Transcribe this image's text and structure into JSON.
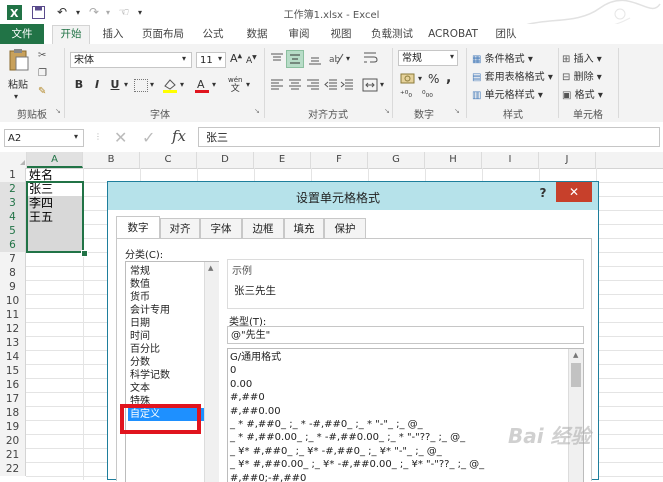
{
  "window": {
    "title": "工作簿1.xlsx - Excel"
  },
  "ribbon_tabs": [
    "文件",
    "开始",
    "插入",
    "页面布局",
    "公式",
    "数据",
    "审阅",
    "视图",
    "负载测试",
    "ACROBAT",
    "团队"
  ],
  "clipboard": {
    "paste_label": "粘贴",
    "group_label": "剪贴板"
  },
  "font": {
    "name": "宋体",
    "size": "11",
    "group_label": "字体",
    "bold": "B",
    "italic": "I",
    "underline": "U",
    "grow": "A",
    "shrink": "A",
    "wen": "wén"
  },
  "alignment": {
    "group_label": "对齐方式"
  },
  "number": {
    "format": "常规",
    "group_label": "数字",
    "percent": "%",
    "comma": ",",
    "inc": "⁺⁰₀",
    "dec": "⁰₀₀"
  },
  "styles": {
    "conditional": "条件格式",
    "table": "套用表格格式",
    "cell": "单元格样式",
    "group_label": "样式"
  },
  "cells": {
    "insert": "插入",
    "delete": "删除",
    "format": "格式",
    "group_label": "单元格"
  },
  "formula_bar": {
    "name_box": "A2",
    "fx": "fx",
    "value": "张三"
  },
  "columns": [
    "A",
    "B",
    "C",
    "D",
    "E",
    "F",
    "G",
    "H",
    "I",
    "J"
  ],
  "rows": [
    "1",
    "2",
    "3",
    "4",
    "5",
    "6",
    "7",
    "8",
    "9",
    "10",
    "11",
    "12",
    "13",
    "14",
    "15",
    "16",
    "17",
    "18",
    "19",
    "20",
    "21",
    "22"
  ],
  "sheet_cells": [
    "姓名",
    "张三",
    "李四",
    "王五"
  ],
  "dialog": {
    "title": "设置单元格格式",
    "help": "?",
    "close": "✕",
    "tabs": [
      "数字",
      "对齐",
      "字体",
      "边框",
      "填充",
      "保护"
    ],
    "category_label": "分类(C):",
    "categories": [
      "常规",
      "数值",
      "货币",
      "会计专用",
      "日期",
      "时间",
      "百分比",
      "分数",
      "科学记数",
      "文本",
      "特殊",
      "自定义"
    ],
    "selected_category": "自定义",
    "sample_label": "示例",
    "sample_value": "张三先生",
    "type_label": "类型(T):",
    "type_value": "@\"先生\"",
    "format_codes": [
      "G/通用格式",
      "0",
      "0.00",
      "#,##0",
      "#,##0.00",
      "_ * #,##0_ ;_ * -#,##0_ ;_ * \"-\"_ ;_ @_",
      "_ * #,##0.00_ ;_ * -#,##0.00_ ;_ * \"-\"??_ ;_ @_",
      "_ ¥* #,##0_ ;_ ¥* -#,##0_ ;_ ¥* \"-\"_ ;_ @_",
      "_ ¥* #,##0.00_ ;_ ¥* -#,##0.00_ ;_ ¥* \"-\"??_ ;_ @_",
      "#,##0;-#,##0"
    ]
  },
  "watermark": "Bai 经验",
  "colors": {
    "excel_green": "#217346",
    "dialog_title": "#b6e2ea",
    "close_red": "#c7402b",
    "selection_blue": "#1e90ff",
    "highlight_red": "#e0141e"
  }
}
